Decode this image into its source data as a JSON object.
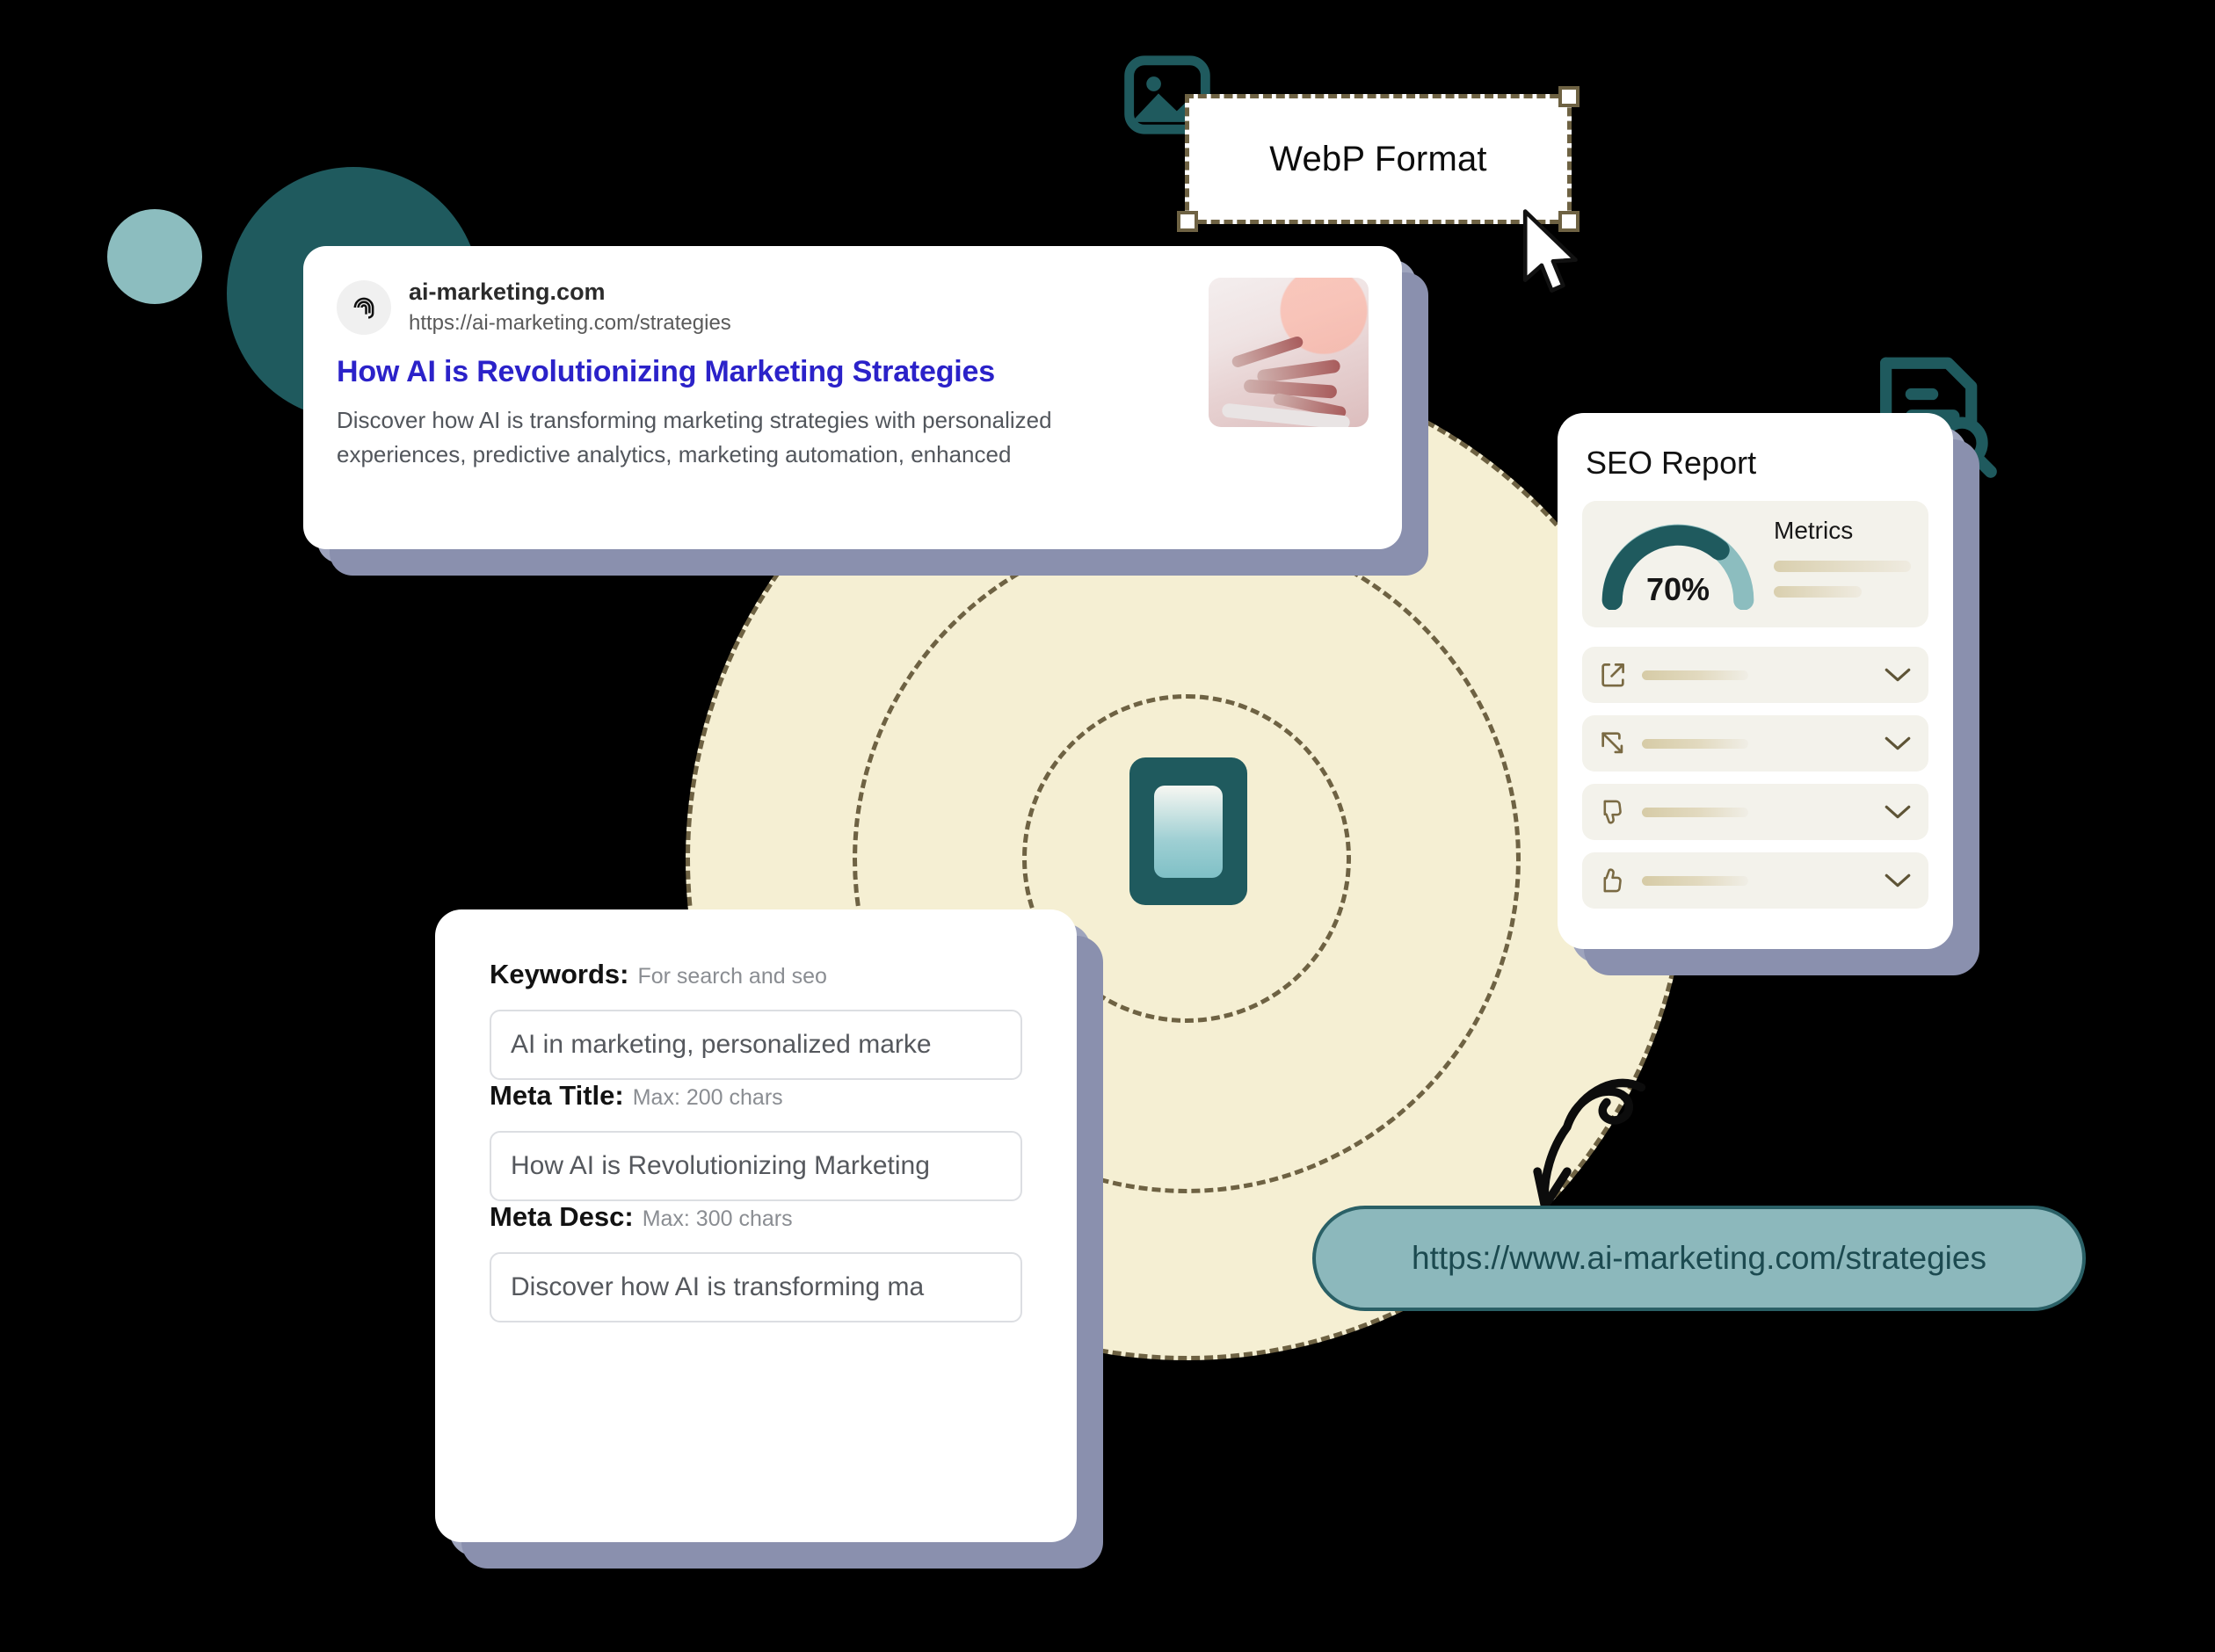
{
  "decor": {
    "circle_small_color": "#8CBDBF",
    "circle_large_color": "#1F5A5E",
    "disc_color": "#F5EFD3",
    "dash_color": "#6E6243"
  },
  "webp_selection": {
    "label": "WebP Format",
    "image_icon": "image-icon",
    "cursor_icon": "cursor-arrow-icon",
    "handles": [
      "top-right",
      "bottom-left",
      "bottom-right"
    ]
  },
  "search_result": {
    "favicon": "brand-logo-icon",
    "site_name": "ai-marketing.com",
    "url": "https://ai-marketing.com/strategies",
    "title": "How AI is Revolutionizing Marketing Strategies",
    "description": "Discover how AI is transforming marketing strategies with personalized experiences, predictive analytics, marketing automation, enhanced",
    "thumbnail": "robot-hands-keyboard-photo",
    "title_color": "#2B22C9"
  },
  "seo_report": {
    "title": "SEO Report",
    "gauge": {
      "value": "70%",
      "percent": 70,
      "filled_color": "#1F5A5E",
      "track_color": "#8CBDBF"
    },
    "metrics_label": "Metrics",
    "rows": [
      {
        "icon": "external-link-icon"
      },
      {
        "icon": "collapse-arrow-icon"
      },
      {
        "icon": "thumbs-down-icon"
      },
      {
        "icon": "thumbs-up-icon"
      }
    ],
    "row_chevron": "chevron-down-icon"
  },
  "form": {
    "fields": [
      {
        "label": "Keywords:",
        "hint": "For search and seo",
        "value": "AI in marketing, personalized marke"
      },
      {
        "label": "Meta Title:",
        "hint": "Max: 200 chars",
        "value": "How AI is Revolutionizing Marketing"
      },
      {
        "label": "Meta Desc:",
        "hint": "Max: 300 chars",
        "value": "Discover how AI is transforming ma"
      }
    ]
  },
  "url_pill": {
    "text": "https://www.ai-marketing.com/strategies",
    "background": "#8CB8BC",
    "border": "#2A6066",
    "text_color": "#1C4A50"
  },
  "doc_icon": "document-search-icon",
  "device_icon": "mobile-device-icon",
  "arrow": "curved-arrow-icon"
}
